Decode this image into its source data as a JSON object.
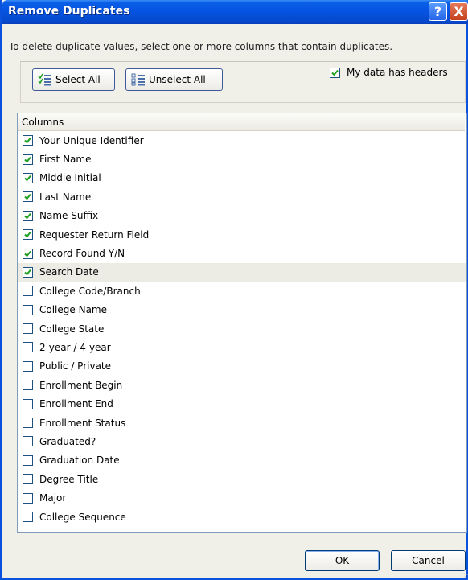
{
  "window": {
    "title": "Remove Duplicates"
  },
  "titlebar": {
    "help_glyph": "?",
    "close_glyph": "X"
  },
  "instruction": "To delete duplicate values, select one or more columns that contain duplicates.",
  "toolbar": {
    "select_all_label": "Select All",
    "unselect_all_label": "Unselect All",
    "headers_label": "My data has headers",
    "headers_checked": true
  },
  "columns": {
    "header": "Columns",
    "items": [
      {
        "label": "Your Unique Identifier",
        "checked": true
      },
      {
        "label": "First Name",
        "checked": true
      },
      {
        "label": "Middle Initial",
        "checked": true
      },
      {
        "label": "Last Name",
        "checked": true
      },
      {
        "label": "Name Suffix",
        "checked": true
      },
      {
        "label": "Requester Return Field",
        "checked": true
      },
      {
        "label": "Record Found Y/N",
        "checked": true
      },
      {
        "label": "Search Date",
        "checked": true,
        "selected": true
      },
      {
        "label": "College Code/Branch",
        "checked": false
      },
      {
        "label": "College Name",
        "checked": false
      },
      {
        "label": "College State",
        "checked": false
      },
      {
        "label": "2-year / 4-year",
        "checked": false
      },
      {
        "label": "Public / Private",
        "checked": false
      },
      {
        "label": "Enrollment Begin",
        "checked": false
      },
      {
        "label": "Enrollment End",
        "checked": false
      },
      {
        "label": "Enrollment Status",
        "checked": false
      },
      {
        "label": "Graduated?",
        "checked": false
      },
      {
        "label": "Graduation Date",
        "checked": false
      },
      {
        "label": "Degree Title",
        "checked": false
      },
      {
        "label": "Major",
        "checked": false
      },
      {
        "label": "College Sequence",
        "checked": false
      }
    ]
  },
  "footer": {
    "ok_label": "OK",
    "cancel_label": "Cancel"
  },
  "colors": {
    "title_bar": "#0553e0",
    "check": "#21a121",
    "list_border": "#7f9db9",
    "selected_row": "#ecebe4"
  }
}
